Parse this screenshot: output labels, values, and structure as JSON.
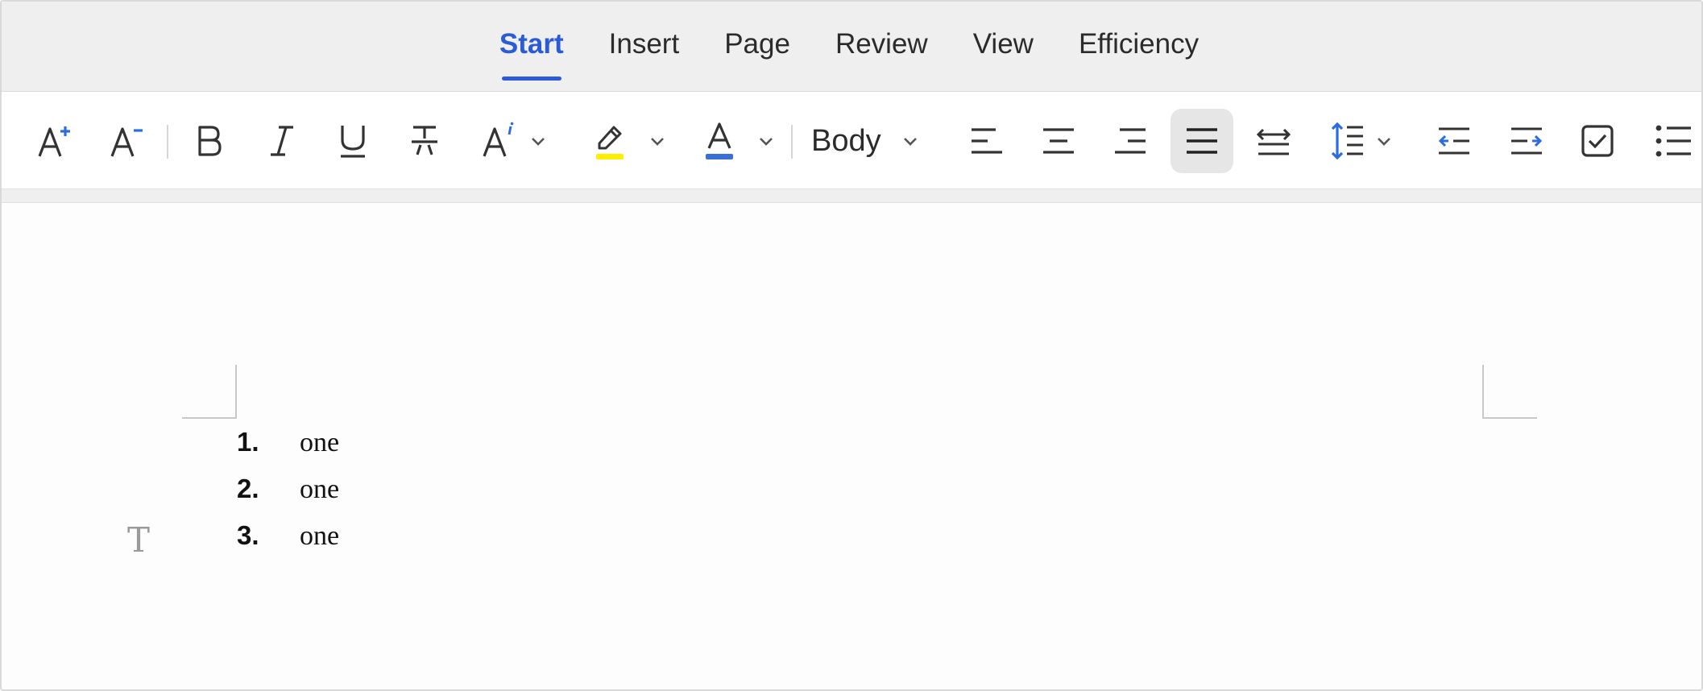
{
  "tabs": [
    {
      "label": "Start",
      "active": true
    },
    {
      "label": "Insert",
      "active": false
    },
    {
      "label": "Page",
      "active": false
    },
    {
      "label": "Review",
      "active": false
    },
    {
      "label": "View",
      "active": false
    },
    {
      "label": "Efficiency",
      "active": false
    }
  ],
  "toolbar": {
    "paragraph_style": "Body",
    "highlight_color": "#ffee00",
    "font_color": "#3a6fd8",
    "accent_color": "#2b5bd7",
    "active_tool": "justify-align",
    "icons": [
      "increase-font-size-icon",
      "decrease-font-size-icon",
      "bold-icon",
      "italic-icon",
      "underline-icon",
      "strikethrough-icon",
      "text-effect-icon",
      "highlighter-icon",
      "font-color-icon",
      "align-left-icon",
      "align-center-icon",
      "align-right-icon",
      "justify-icon",
      "distributed-icon",
      "line-spacing-icon",
      "decrease-indent-icon",
      "increase-indent-icon",
      "checkbox-icon",
      "bulleted-list-icon"
    ]
  },
  "document": {
    "list": [
      {
        "number": "1.",
        "text": "one"
      },
      {
        "number": "2.",
        "text": "one"
      },
      {
        "number": "3.",
        "text": "one"
      }
    ],
    "text_marker": "T"
  }
}
